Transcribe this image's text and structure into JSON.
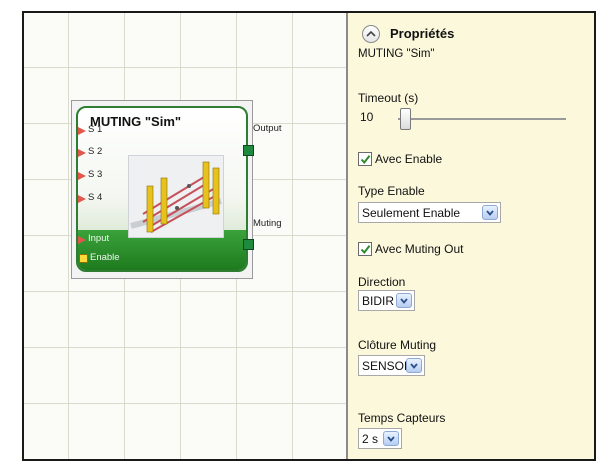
{
  "block": {
    "title": "MUTING \"Sim\"",
    "inputs": [
      "S 1",
      "S 2",
      "S 3",
      "S 4",
      "Input"
    ],
    "enable_label": "Enable",
    "outputs": [
      "Output",
      "Muting"
    ]
  },
  "panel": {
    "title": "Propriétés",
    "subtitle": "MUTING \"Sim\"",
    "timeout_label": "Timeout (s)",
    "timeout_value": "10",
    "avec_enable": {
      "label": "Avec Enable",
      "checked": true
    },
    "type_enable_label": "Type Enable",
    "type_enable_value": "Seulement Enable",
    "avec_muting_out": {
      "label": "Avec Muting Out",
      "checked": true
    },
    "direction_label": "Direction",
    "direction_value": "BIDIR",
    "cloture_label": "Clôture Muting",
    "cloture_value": "SENSOR",
    "temps_label": "Temps Capteurs",
    "temps_value": "2 s"
  },
  "colors": {
    "block_green": "#2e9a2e",
    "panel_background": "#fbf8dc",
    "input_pin": "#e2574c",
    "enable_pin": "#ffd83a",
    "output_pin": "#1e8a3e"
  },
  "icons": [
    "collapse-up-icon",
    "check-icon",
    "dropdown-arrow-icon"
  ]
}
